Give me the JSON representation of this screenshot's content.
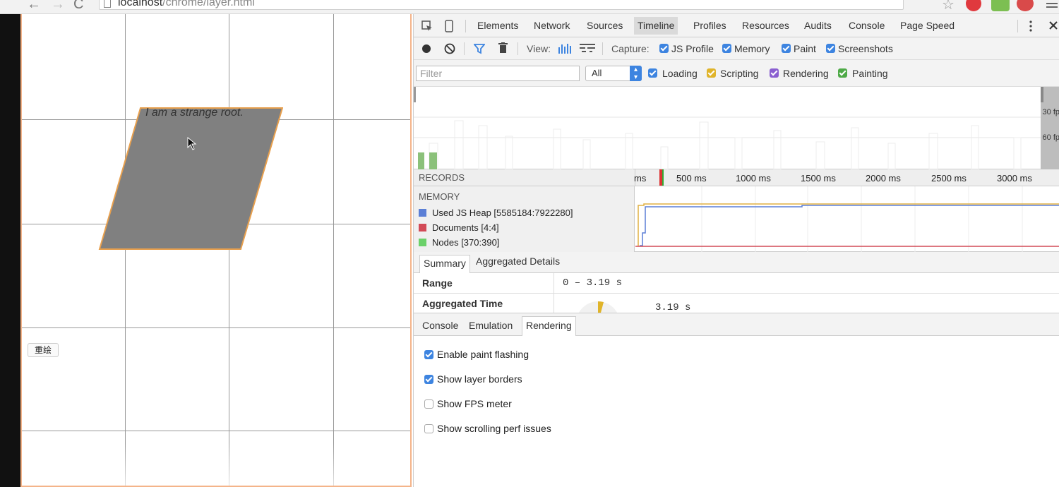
{
  "browser": {
    "url_host": "localhost",
    "url_path": "/chrome/layer.html"
  },
  "page": {
    "parallelogram_text": "I am a strange root.",
    "repaint_button": "重绘"
  },
  "devtools": {
    "tabs": [
      "Elements",
      "Network",
      "Sources",
      "Timeline",
      "Profiles",
      "Resources",
      "Audits",
      "Console",
      "Page Speed"
    ],
    "active_tab": "Timeline",
    "toolbar": {
      "view_label": "View:",
      "capture_label": "Capture:",
      "capture_options": [
        {
          "label": "JS Profile",
          "checked": true
        },
        {
          "label": "Memory",
          "checked": true
        },
        {
          "label": "Paint",
          "checked": true
        },
        {
          "label": "Screenshots",
          "checked": true
        }
      ]
    },
    "filter": {
      "placeholder": "Filter",
      "select_value": "All",
      "categories": [
        {
          "label": "Loading",
          "color": "#3d84e0",
          "checked": true
        },
        {
          "label": "Scripting",
          "color": "#e0b42a",
          "checked": true
        },
        {
          "label": "Rendering",
          "color": "#8a5fd0",
          "checked": true
        },
        {
          "label": "Painting",
          "color": "#4eaa47",
          "checked": true
        }
      ]
    },
    "overview": {
      "fps_30": "30 fp",
      "fps_60": "60 fp"
    },
    "records": {
      "label": "RECORDS",
      "ticks": [
        "ms",
        "500 ms",
        "1000 ms",
        "1500 ms",
        "2000 ms",
        "2500 ms",
        "3000 ms"
      ]
    },
    "memory": {
      "label": "MEMORY",
      "items": [
        {
          "label": "Used JS Heap [5585184:7922280]",
          "color": "#5b7fd6"
        },
        {
          "label": "Documents [4:4]",
          "color": "#d24a57"
        },
        {
          "label": "Nodes [370:390]",
          "color": "#6bd16a"
        }
      ]
    },
    "summary_tabs": [
      "Summary",
      "Aggregated Details"
    ],
    "summary": {
      "range_label": "Range",
      "range_value": "0 – 3.19 s",
      "aggregated_label": "Aggregated Time",
      "aggregated_value": "3.19 s"
    },
    "drawer_tabs": [
      "Console",
      "Emulation",
      "Rendering"
    ],
    "drawer_active": "Rendering",
    "rendering_options": [
      {
        "label": "Enable paint flashing",
        "checked": true
      },
      {
        "label": "Show layer borders",
        "checked": true
      },
      {
        "label": "Show FPS meter",
        "checked": false
      },
      {
        "label": "Show scrolling perf issues",
        "checked": false
      }
    ]
  }
}
